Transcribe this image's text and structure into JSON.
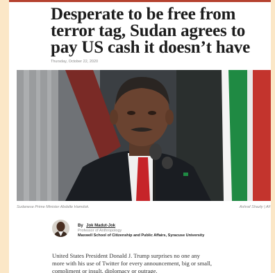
{
  "article": {
    "headline": "Desperate to be free from terror tag, Sudan agrees to pay US cash it doesn’t have",
    "date": "Thursday, October 22, 2020",
    "photo_caption": "Sudanese Prime Minister Abdalle Hamdok.",
    "photo_credit": "Ashraf Shazly | AF",
    "author": {
      "by": "By",
      "name": "Jok Madut-Jok",
      "title": "Professor of Anthropology",
      "affiliation": "Maxwell School of Citizenship and Public Affairs, Syracuse University"
    },
    "body_lines": [
      "United States President Donald J. Trump surprises no one any",
      "more with his use of Twitter for every announcement, big or small,",
      "compliment or insult, diplomacy or outrage."
    ]
  },
  "colors": {
    "page_background": "#fdf3de",
    "accent_rule": "#b5422f",
    "article_background": "#ffffff"
  }
}
